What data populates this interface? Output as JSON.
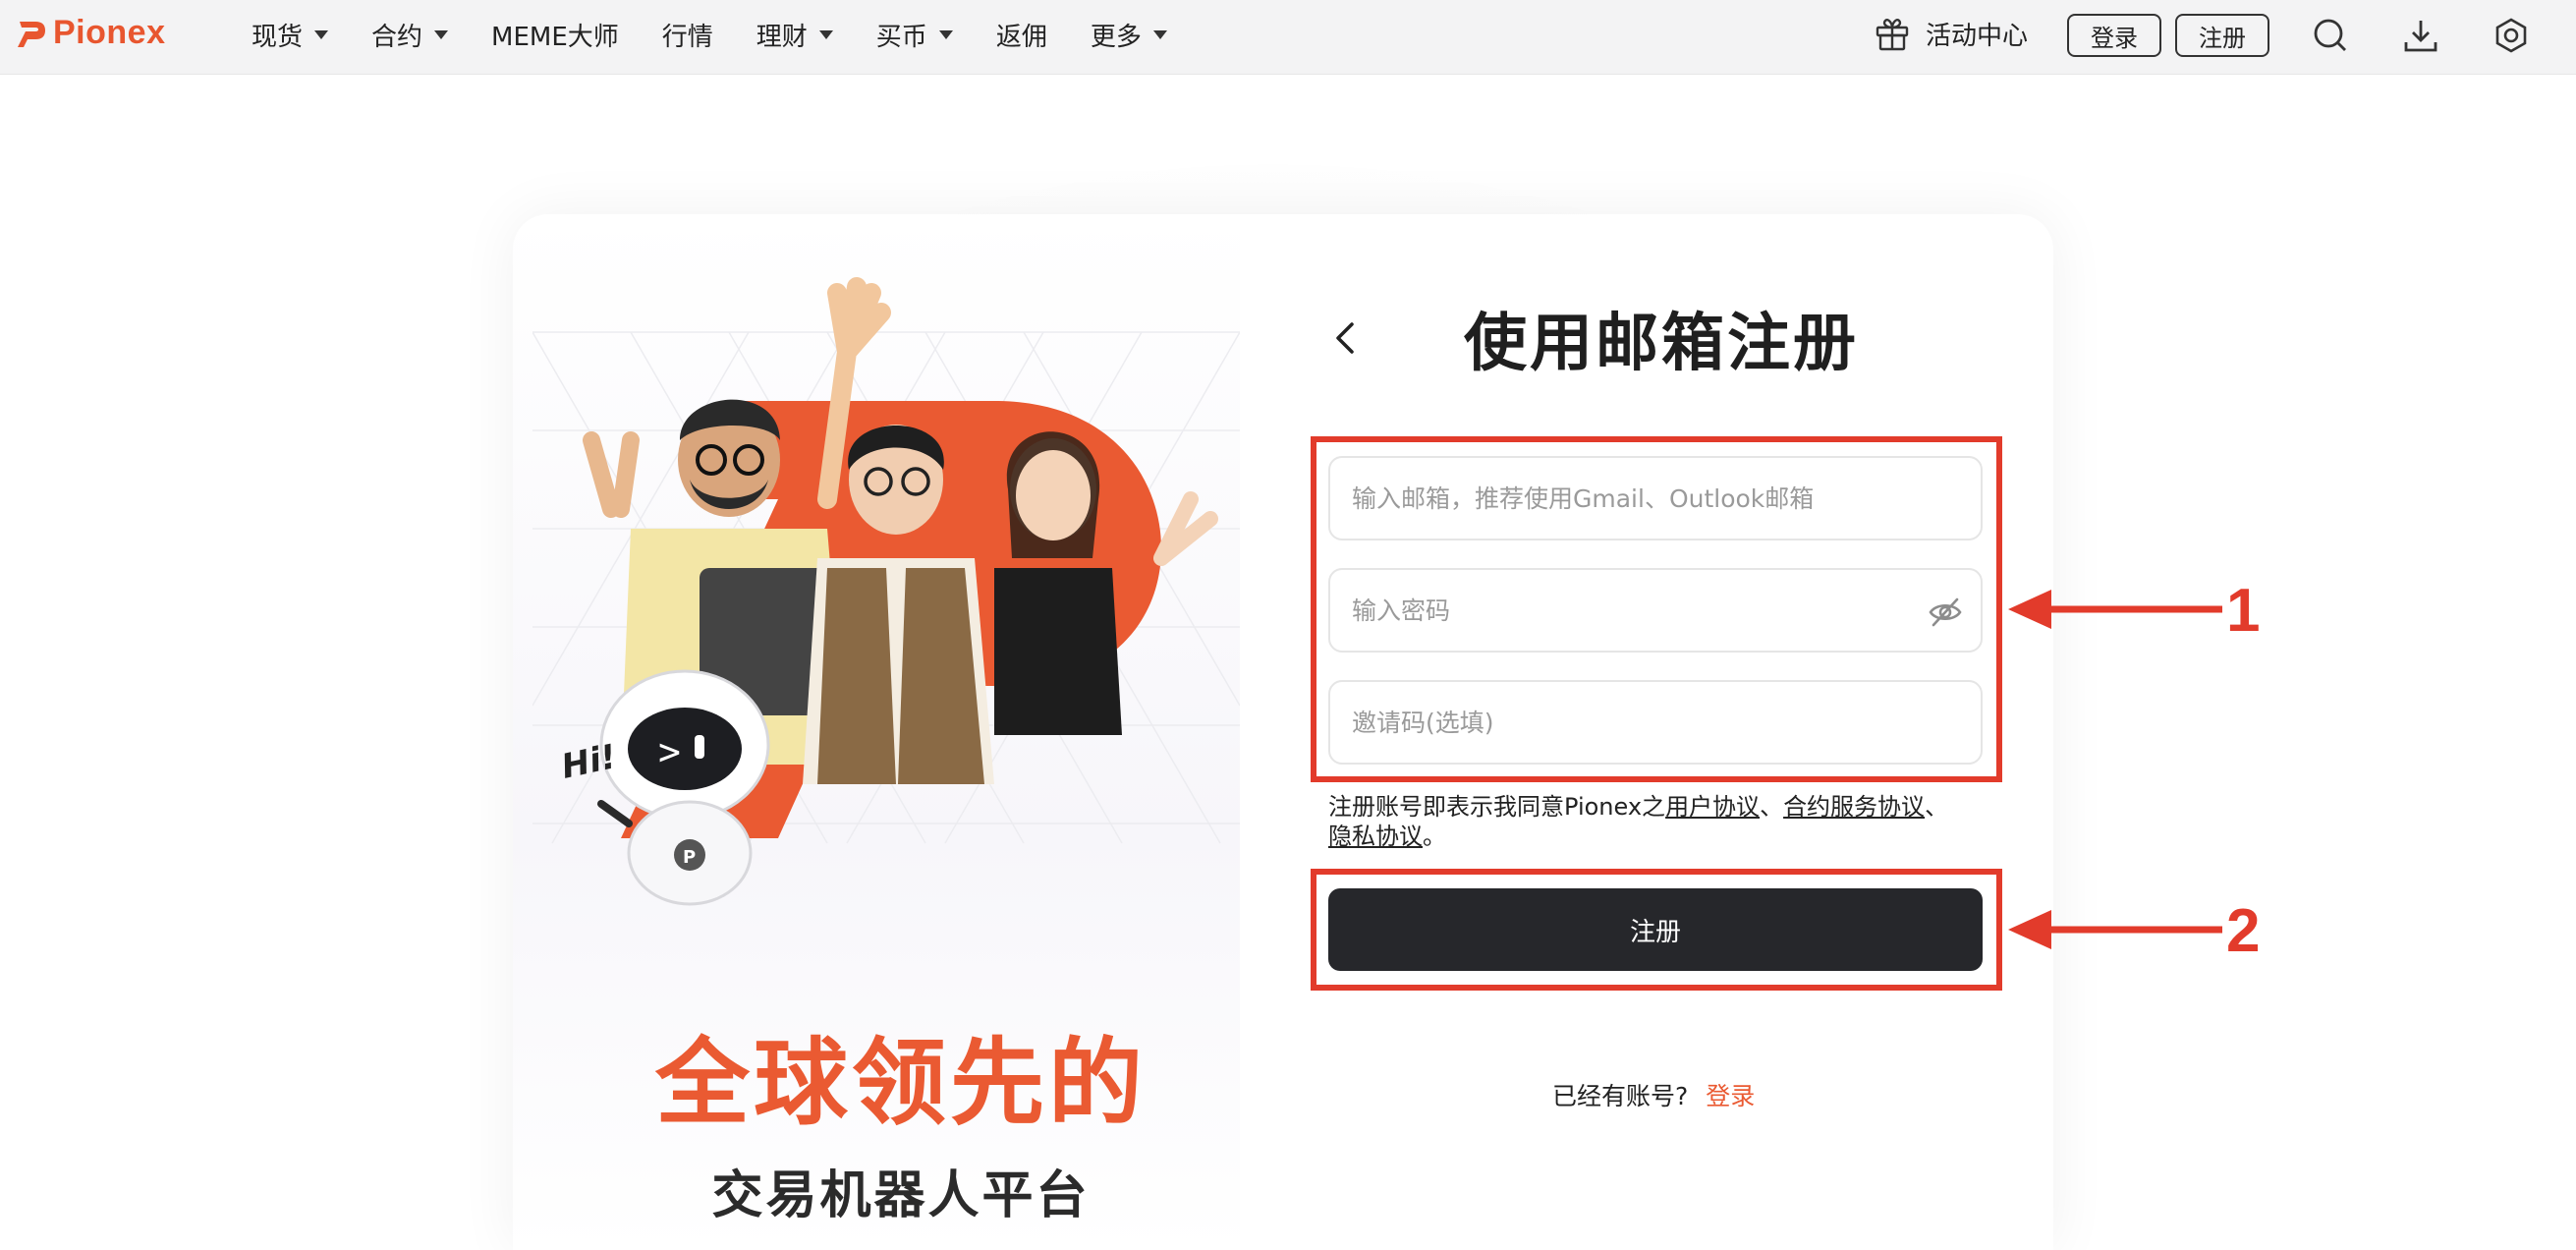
{
  "brand": {
    "name": "Pionex",
    "accent": "#ea5a32"
  },
  "nav": {
    "menu": [
      {
        "label": "现货",
        "has_dropdown": true
      },
      {
        "label": "合约",
        "has_dropdown": true
      },
      {
        "label": "MEME大师",
        "has_dropdown": false
      },
      {
        "label": "行情",
        "has_dropdown": false
      },
      {
        "label": "理财",
        "has_dropdown": true
      },
      {
        "label": "买币",
        "has_dropdown": true
      },
      {
        "label": "返佣",
        "has_dropdown": false
      },
      {
        "label": "更多",
        "has_dropdown": true
      }
    ],
    "activity_label": "活动中心",
    "login_label": "登录",
    "register_label": "注册",
    "icons": [
      "gift-icon",
      "search-icon",
      "download-icon",
      "settings-icon"
    ]
  },
  "promo": {
    "title": "全球领先的",
    "subtitle": "交易机器人平台",
    "bubble_text": "Hi!"
  },
  "form": {
    "title": "使用邮箱注册",
    "email_placeholder": "输入邮箱，推荐使用Gmail、Outlook邮箱",
    "password_placeholder": "输入密码",
    "invite_placeholder": "邀请码(选填)",
    "agreement_prefix": "注册账号即表示我同意Pionex之",
    "agreement_user": "用户协议",
    "agreement_sep1": "、",
    "agreement_contract": "合约服务协议",
    "agreement_sep2": "、",
    "agreement_privacy": "隐私协议",
    "agreement_end": "。",
    "submit_label": "注册",
    "have_account": "已经有账号?",
    "login_link": "登录"
  },
  "annotations": [
    {
      "label": "1"
    },
    {
      "label": "2"
    }
  ]
}
